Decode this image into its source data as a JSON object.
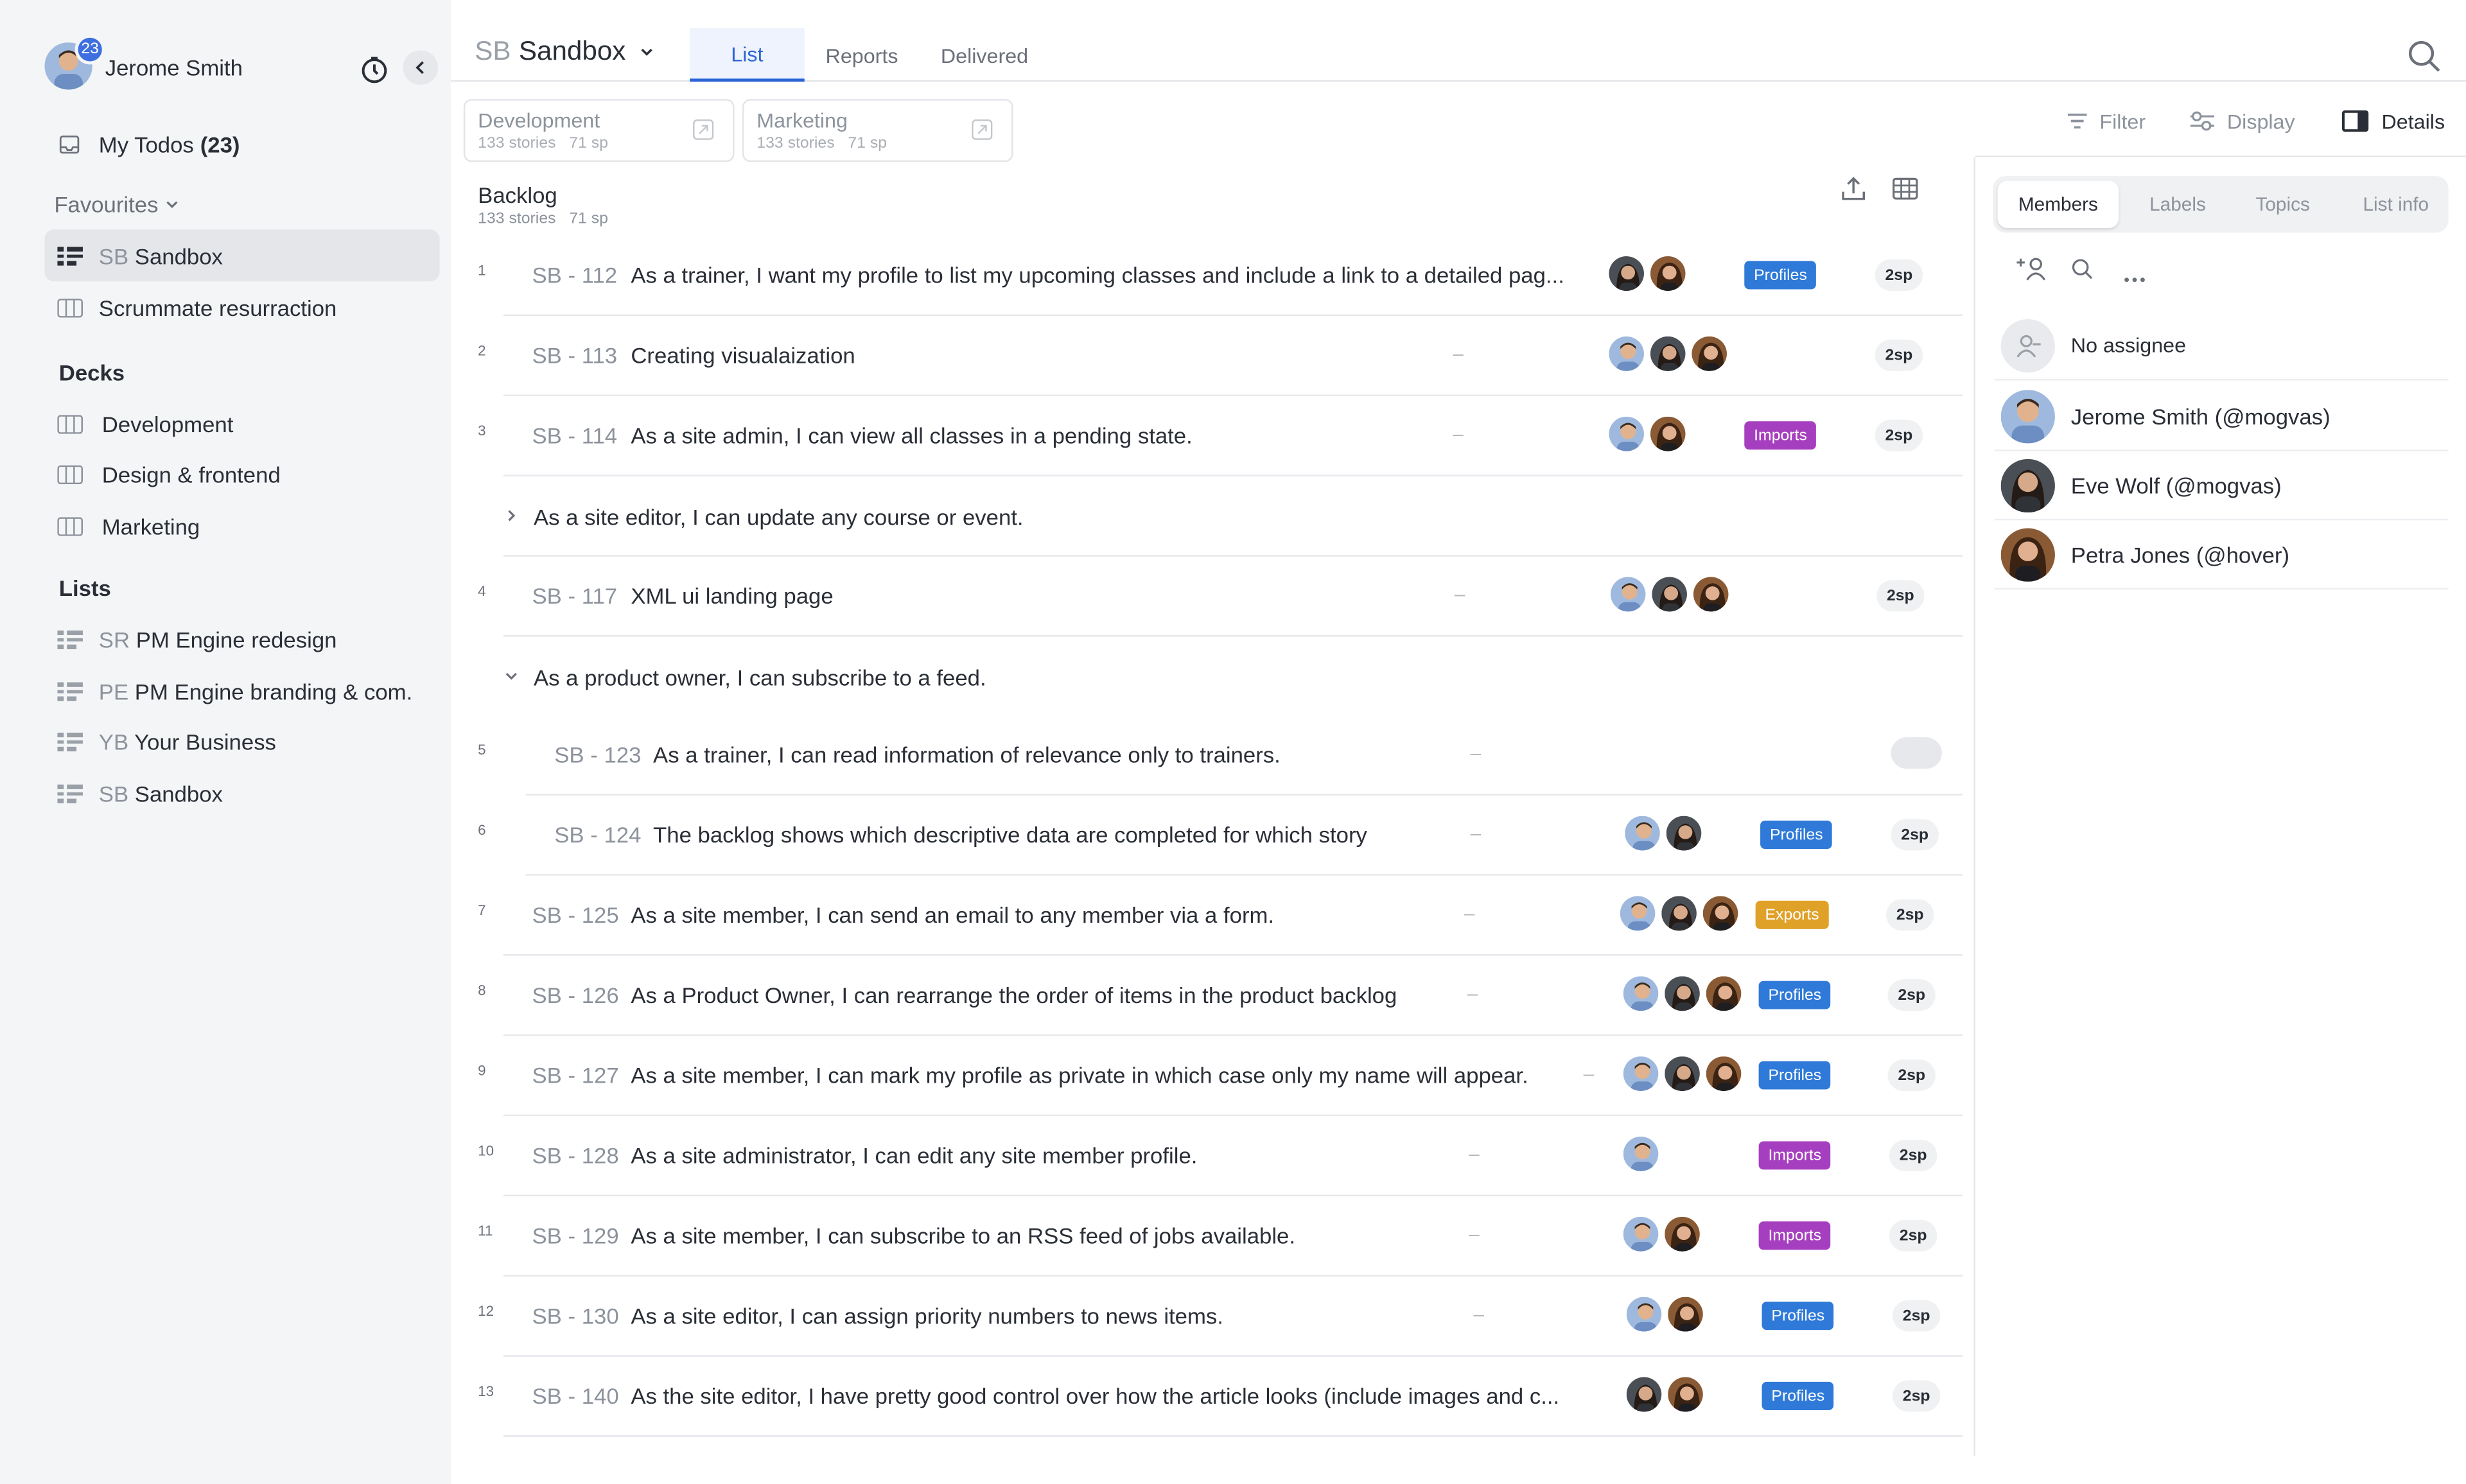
{
  "colors": {
    "accent": "#2c64d6",
    "tag_profiles": "#2f7ad8",
    "tag_imports": "#a63fbf",
    "tag_exports": "#e0a128",
    "badge_count": "#3d6fe0"
  },
  "user": {
    "name": "Jerome Smith",
    "badge_count": "23"
  },
  "sidebar": {
    "my_todos_label": "My Todos",
    "my_todos_count": "(23)",
    "favourites_title": "Favourites",
    "favourites": [
      {
        "prefix": "SB",
        "label": "Sandbox",
        "icon": "list-icon"
      },
      {
        "prefix": "",
        "label": "Scrummate resurraction",
        "icon": "board-icon"
      }
    ],
    "decks_title": "Decks",
    "decks": [
      {
        "label": "Development"
      },
      {
        "label": "Design & frontend"
      },
      {
        "label": "Marketing"
      }
    ],
    "lists_title": "Lists",
    "lists": [
      {
        "prefix": "SR",
        "label": "PM Engine redesign"
      },
      {
        "prefix": "PE",
        "label": "PM Engine branding & com."
      },
      {
        "prefix": "YB",
        "label": "Your Business"
      },
      {
        "prefix": "SB",
        "label": "Sandbox"
      }
    ]
  },
  "header": {
    "project_prefix": "SB",
    "project_name": "Sandbox",
    "tabs": [
      {
        "label": "List"
      },
      {
        "label": "Reports"
      },
      {
        "label": "Delivered"
      }
    ]
  },
  "deck_cards": [
    {
      "title": "Development",
      "stories": "133 stories",
      "sp": "71 sp"
    },
    {
      "title": "Marketing",
      "stories": "133 stories",
      "sp": "71 sp"
    }
  ],
  "toolbar": {
    "filter_label": "Filter",
    "display_label": "Display",
    "details_label": "Details"
  },
  "backlog": {
    "title": "Backlog",
    "stories": "133 stories",
    "sp": "71 sp"
  },
  "rows": [
    {
      "num": "1",
      "code": "SB - 112",
      "title": "As a trainer, I want my profile to list my upcoming classes and include a link to a detailed pag...",
      "dash": "",
      "tag": "Profiles",
      "sp": "2sp"
    },
    {
      "num": "2",
      "code": "SB - 113",
      "title": "Creating visualaization",
      "dash": "–",
      "tag": "",
      "sp": "2sp"
    },
    {
      "num": "3",
      "code": "SB - 114",
      "title": "As a site admin, I can view all classes in a pending state.",
      "dash": "–",
      "tag": "Imports",
      "sp": "2sp"
    },
    {
      "num": "4",
      "code": "SB - 117",
      "title": "XML ui landing page",
      "dash": "–",
      "tag": "",
      "sp": "2sp"
    },
    {
      "num": "5",
      "code": "SB - 123",
      "title": "As a trainer, I can read information of relevance only to trainers.",
      "dash": "–",
      "tag": "",
      "sp": ""
    },
    {
      "num": "6",
      "code": "SB - 124",
      "title": "The backlog shows which descriptive data are completed for which story",
      "dash": "–",
      "tag": "Profiles",
      "sp": "2sp"
    },
    {
      "num": "7",
      "code": "SB - 125",
      "title": "As a site member, I can send an email to any member via a form.",
      "dash": "–",
      "tag": "Exports",
      "sp": "2sp"
    },
    {
      "num": "8",
      "code": "SB - 126",
      "title": "As a Product Owner, I can rearrange the order of items in the product backlog",
      "dash": "–",
      "tag": "Profiles",
      "sp": "2sp"
    },
    {
      "num": "9",
      "code": "SB - 127",
      "title": "As a site member, I can mark my profile as private in which case only my name will appear.",
      "dash": "–",
      "tag": "Profiles",
      "sp": "2sp"
    },
    {
      "num": "10",
      "code": "SB - 128",
      "title": "As a site administrator, I can edit any site member profile.",
      "dash": "–",
      "tag": "Imports",
      "sp": "2sp"
    },
    {
      "num": "11",
      "code": "SB - 129",
      "title": "As a site member, I can subscribe to an RSS feed of jobs available.",
      "dash": "–",
      "tag": "Imports",
      "sp": "2sp"
    },
    {
      "num": "12",
      "code": "SB - 130",
      "title": "As a site editor, I can assign priority numbers to news items.",
      "dash": "–",
      "tag": "Profiles",
      "sp": "2sp"
    },
    {
      "num": "13",
      "code": "SB - 140",
      "title": "As the site editor, I have pretty good control over how the article looks (include images and c...",
      "dash": "",
      "tag": "Profiles",
      "sp": "2sp"
    }
  ],
  "groups": [
    {
      "title": "As a site editor, I can update any course or event."
    },
    {
      "title": "As a product owner, I can subscribe to a feed."
    }
  ],
  "details_panel": {
    "tabs": [
      {
        "label": "Members"
      },
      {
        "label": "Labels"
      },
      {
        "label": "Topics"
      },
      {
        "label": "List info"
      }
    ],
    "no_assignee": "No assignee",
    "members": [
      {
        "name": "Jerome Smith (@mogvas)"
      },
      {
        "name": "Eve Wolf (@mogvas)"
      },
      {
        "name": "Petra Jones (@hover)"
      }
    ]
  }
}
